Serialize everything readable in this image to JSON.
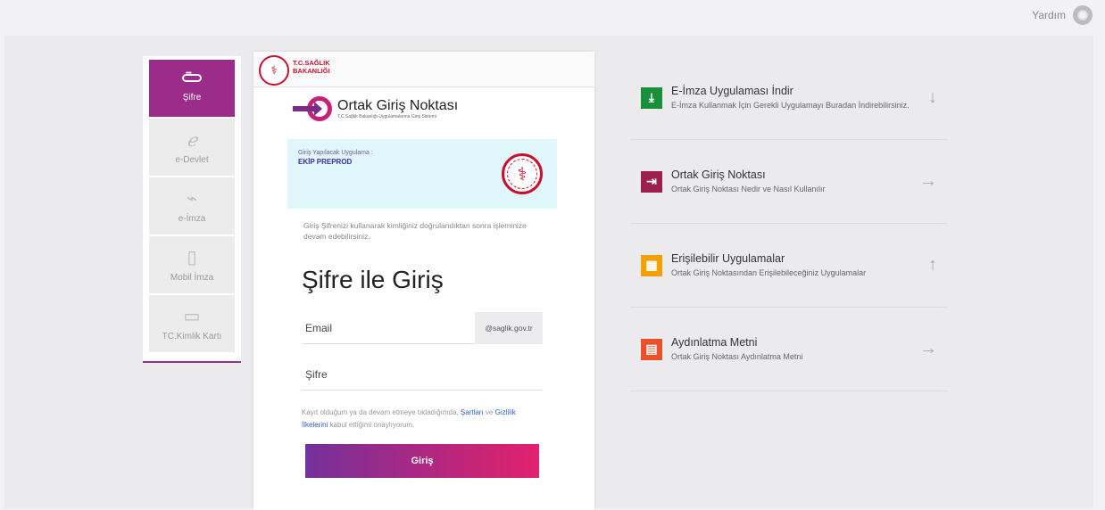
{
  "header": {
    "help_label": "Yardım",
    "help_icon": "help-lifebuoy-icon"
  },
  "methods": [
    {
      "label": "Şifre",
      "icon": "password-icon",
      "active": true
    },
    {
      "label": "e-Devlet",
      "icon": "edevlet-icon",
      "active": false
    },
    {
      "label": "e-İmza",
      "icon": "usb-key-icon",
      "active": false
    },
    {
      "label": "Mobil İmza",
      "icon": "mobile-phone-icon",
      "active": false
    },
    {
      "label": "TC.Kimlik Kartı",
      "icon": "id-card-icon",
      "active": false
    }
  ],
  "card": {
    "ministry_line1": "T.C.SAĞLIK",
    "ministry_line2": "BAKANLIĞI",
    "brand_name": "Ortak Giriş Noktası",
    "brand_sub": "T.C.Sağlık Bakanlığı Uygulamalarına Giriş Sistemi",
    "app_label": "Giriş Yapılacak Uygulama :",
    "app_name": "EKİP PREPROD",
    "info_text": "Giriş Şifrenizi kullanarak kimliğiniz doğrulandıktan sonra işleminize devam edebilirsiniz.",
    "login_title": "Şifre ile Giriş",
    "email_placeholder": "Email",
    "email_suffix": "@saglik.gov.tr",
    "password_placeholder": "Şifre",
    "terms_before": "Kayıt olduğum ya da devam etmeye tıkladığımda,",
    "terms_link1": "Şartları",
    "terms_middle": "ve",
    "terms_link2": "Gizlilik İlkelerini",
    "terms_after": "kabul ettiğimi onaylıyorum.",
    "login_button": "Giriş"
  },
  "links": [
    {
      "title": "E-İmza Uygulaması İndir",
      "desc": "E-İmza Kullanmak İçin Gerekli Uygulamayı Buradan İndirebilirsiniz.",
      "icon": "download-icon",
      "arrow": "↓",
      "color": "#1a8f3a"
    },
    {
      "title": "Ortak Giriş Noktası",
      "desc": "Ortak Giriş Noktası Nedir ve Nasıl Kullanılır",
      "icon": "sign-in-icon",
      "arrow": "→",
      "color": "#9d1f4e"
    },
    {
      "title": "Erişilebilir Uygulamalar",
      "desc": "Ortak Giriş Noktasından Erişilebileceğiniz Uygulamalar",
      "icon": "apps-grid-icon",
      "arrow": "↑",
      "color": "#f2a200"
    },
    {
      "title": "Aydınlatma Metni",
      "desc": "Ortak Giriş Noktası Aydınlatma Metni",
      "icon": "document-icon",
      "arrow": "→",
      "color": "#e8512a"
    }
  ]
}
